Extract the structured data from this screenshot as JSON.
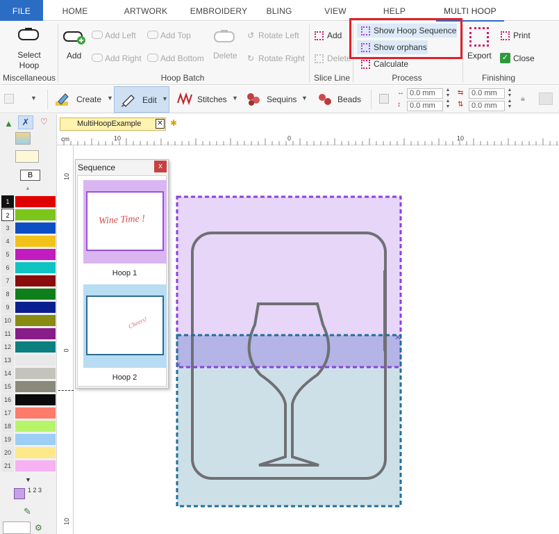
{
  "tabs": [
    {
      "label": "FILE"
    },
    {
      "label": "HOME"
    },
    {
      "label": "ARTWORK"
    },
    {
      "label": "EMBROIDERY"
    },
    {
      "label": "BLING"
    },
    {
      "label": "VIEW"
    },
    {
      "label": "HELP"
    },
    {
      "label": "MULTI HOOP"
    }
  ],
  "ribbon": {
    "misc": {
      "select_hoop": "Select\nHoop",
      "group": "Miscellaneous"
    },
    "hoop_batch": {
      "add": "Add",
      "add_left": "Add Left",
      "add_right": "Add Right",
      "add_top": "Add Top",
      "add_bottom": "Add Bottom",
      "delete": "Delete",
      "rotate_left": "Rotate Left",
      "rotate_right": "Rotate Right",
      "group": "Hoop Batch"
    },
    "slice_line": {
      "add": "Add",
      "delete": "Delete",
      "group": "Slice Line"
    },
    "process": {
      "show_hoop_sequence": "Show Hoop Sequence",
      "show_orphans": "Show orphans",
      "calculate": "Calculate",
      "group": "Process"
    },
    "finishing": {
      "export": "Export",
      "print": "Print",
      "close": "Close",
      "group": "Finishing"
    }
  },
  "toolbar": {
    "create": "Create",
    "edit": "Edit",
    "stitches": "Stitches",
    "sequins": "Sequins",
    "beads": "Beads",
    "fields": [
      "0.0 mm",
      "0.0 mm",
      "0.0 mm",
      "0.0 mm"
    ]
  },
  "document": {
    "tab_label": "MultiHoopExample"
  },
  "ruler": {
    "unit": "cm",
    "h_ticks": [
      "10",
      "0",
      "10"
    ],
    "v_ticks": [
      "10",
      "0",
      "10"
    ]
  },
  "palette": {
    "b_label": "B",
    "colors": [
      {
        "num": "1",
        "hex": "#e00000"
      },
      {
        "num": "2",
        "hex": "#7cc61c"
      },
      {
        "num": "3",
        "hex": "#0d4ec6"
      },
      {
        "num": "4",
        "hex": "#f2c21a"
      },
      {
        "num": "5",
        "hex": "#c01cc0"
      },
      {
        "num": "6",
        "hex": "#10c4c4"
      },
      {
        "num": "7",
        "hex": "#8a0c0c"
      },
      {
        "num": "8",
        "hex": "#0f7f1a"
      },
      {
        "num": "9",
        "hex": "#0a1f8f"
      },
      {
        "num": "10",
        "hex": "#888a14"
      },
      {
        "num": "11",
        "hex": "#881c88"
      },
      {
        "num": "12",
        "hex": "#0c8080"
      },
      {
        "num": "13",
        "hex": "#e8e8e8"
      },
      {
        "num": "14",
        "hex": "#c4c4bc"
      },
      {
        "num": "15",
        "hex": "#8a8a7a"
      },
      {
        "num": "16",
        "hex": "#0a0a0a"
      },
      {
        "num": "17",
        "hex": "#ff7b6b"
      },
      {
        "num": "18",
        "hex": "#b6f56a"
      },
      {
        "num": "19",
        "hex": "#9ccef6"
      },
      {
        "num": "20",
        "hex": "#fde88a"
      },
      {
        "num": "21",
        "hex": "#f6b2f2"
      }
    ],
    "sequence_label": "1 2 3"
  },
  "sequence_panel": {
    "title": "Sequence",
    "close": "x",
    "hoops": [
      {
        "name": "Hoop 1",
        "caption": "Wine Time !",
        "bg": "#d9b6f2",
        "frame": "#9b4fd8",
        "text_color": "#e04a4a"
      },
      {
        "name": "Hoop 2",
        "caption": "Cheers!",
        "bg": "#b8dcf2",
        "frame": "#2a6a90",
        "text_color": "#e07070"
      }
    ]
  },
  "colors": {
    "accent": "#2b6cc4",
    "highlight": "#e0212b",
    "hoop1_fill": "#e7d6f8",
    "hoop1_border": "#9b4fe0",
    "hoop2_fill": "#cde0e8",
    "hoop2_border": "#1f6e9c",
    "overlap_fill": "#b4b4e6",
    "artwork_stroke": "#6f7074"
  }
}
